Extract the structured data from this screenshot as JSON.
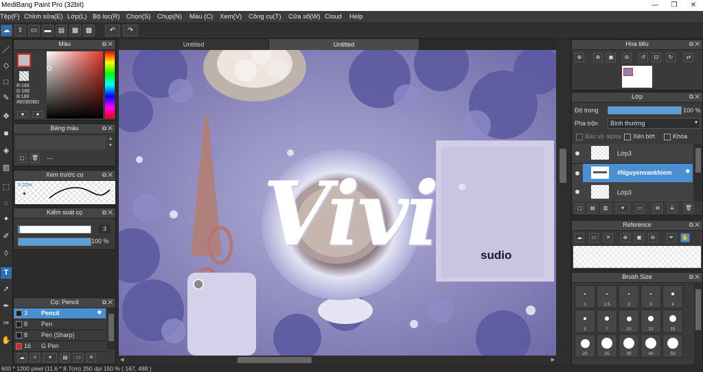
{
  "app": {
    "title": "MediBang Paint Pro (32bit)"
  },
  "window_controls": {
    "minimize": "—",
    "restore": "❐",
    "close": "✕"
  },
  "menu": [
    "Tệp(F)",
    "Chỉnh sửa(E)",
    "Lớp(L)",
    "Bộ lọc(R)",
    "Chọn(S)",
    "Chụp(N)",
    "Màu (C)",
    "Xem(V)",
    "Công cụ(T)",
    "Cửa sổ(W)",
    "Cloud",
    "Help"
  ],
  "toolbar_icons": [
    "cloud-upload-icon",
    "export-icon",
    "comment-icon",
    "save-icon",
    "grid-icon",
    "snap-icon",
    "undo-icon",
    "redo-icon"
  ],
  "color_panel": {
    "title": "Màu",
    "r": "R:189",
    "g": "G:189",
    "b": "B:189",
    "hex": "#BDBDBD",
    "current_color": "#bdbdbd"
  },
  "palette_panel": {
    "title": "Bảng màu",
    "value": "---"
  },
  "brush_preview_panel": {
    "title": "Xem trước cọ",
    "size_label": "0.22m"
  },
  "brush_control_panel": {
    "title": "Kiểm soát cọ",
    "size_value": "3",
    "opacity_value": "100 %",
    "opacity_fraction": 1.0
  },
  "brush_list_panel": {
    "title": "Cọ: Pencil",
    "items": [
      {
        "size": "3",
        "name": "Pencil",
        "color": "#1e1e1e",
        "selected": true
      },
      {
        "size": "8",
        "name": "Pen",
        "color": "#1e1e1e",
        "selected": false
      },
      {
        "size": "8",
        "name": "Pen (Sharp)",
        "color": "#1e1e1e",
        "selected": false
      },
      {
        "size": "16",
        "name": "G Pen",
        "color": "#e02020",
        "selected": false
      }
    ]
  },
  "tabs": [
    {
      "label": "Untitled"
    },
    {
      "label": "Untitled"
    }
  ],
  "canvas": {
    "lettering": "Vivi",
    "brand": "sudio",
    "watermark": "#Nguyenvankhiem"
  },
  "navigator_panel": {
    "title": "Hoa tiêu"
  },
  "layer_panel": {
    "title": "Lớp",
    "opacity_label": "Độ trong",
    "opacity_value": "100 %",
    "opacity_fraction": 1.0,
    "blend_label": "Pha trộn",
    "blend_value": "Bình thường",
    "protect_alpha": "Bảo vệ alpha",
    "clipping": "Xén bớt",
    "lock": "Khóa",
    "layers": [
      {
        "name": "Lớp3",
        "selected": false
      },
      {
        "name": "#Nguyenvankhiem",
        "selected": true
      },
      {
        "name": "Lớp3",
        "selected": false
      }
    ]
  },
  "reference_panel": {
    "title": "Reference"
  },
  "brush_size_panel": {
    "title": "Brush Size",
    "sizes": [
      "1",
      "1.5",
      "2",
      "3",
      "4",
      "5",
      "7",
      "10",
      "12",
      "15",
      "20",
      "25",
      "30",
      "40",
      "50"
    ]
  },
  "status": {
    "text": "600 * 1200 pixel  (11.6 * 8.7cm)  250 dpi  150 %  ( 167, 488 )"
  }
}
